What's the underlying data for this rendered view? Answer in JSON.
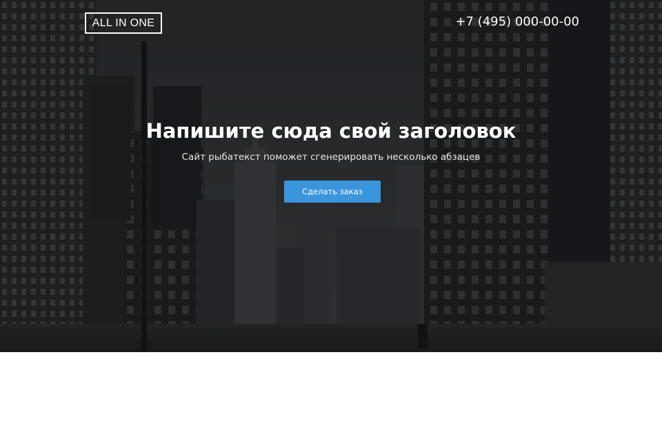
{
  "header": {
    "logo_text": "ALL IN ONE",
    "phone": "+7 (495) 000-00-00"
  },
  "hero": {
    "title": "Напишите сюда свой заголовок",
    "subtitle": "Сайт рыбатекст поможет сгенерировать несколько абзацев",
    "cta_label": "Сделать заказ"
  },
  "colors": {
    "cta_background": "#3a95dd",
    "hero_text": "#ffffff",
    "page_background": "#ffffff"
  }
}
